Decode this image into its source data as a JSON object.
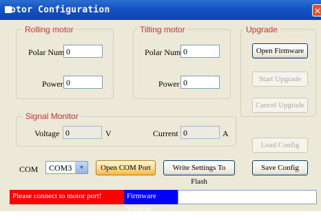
{
  "window": {
    "title": "otor Configuration",
    "close_glyph": "✕"
  },
  "rolling": {
    "title": "Rolling motor",
    "polar_label": "Polar Num",
    "polar_value": "0",
    "power_label": "Power",
    "power_value": "0"
  },
  "tilting": {
    "title": "Tilting motor",
    "polar_label": "Polar Num",
    "polar_value": "0",
    "power_label": "Power",
    "power_value": "0"
  },
  "upgrade": {
    "title": "Upgrade",
    "open_firmware": "Open Firmware",
    "start_upgrade": "Start Upgrade",
    "cancel_upgrade": "Cancel Upgrade"
  },
  "signal": {
    "title": "Signal Monitor",
    "voltage_label": "Voltage",
    "voltage_value": "0",
    "voltage_unit": "V",
    "current_label": "Current",
    "current_value": "0",
    "current_unit": "A"
  },
  "config": {
    "load": "Load Config",
    "save": "Save Config"
  },
  "com": {
    "label": "COM",
    "selected": "COM3",
    "open_port": "Open COM Port",
    "write_flash": "Write Settings To Flash"
  },
  "status": {
    "message": "Please connect to motor port!",
    "firmware_label": "Firmware Version:",
    "firmware_value": ""
  },
  "colors": {
    "titlebar": "#1552c4",
    "group_label": "#cc3333",
    "status_error_bg": "#ff0000",
    "status_firmware_bg": "#0000ff"
  }
}
